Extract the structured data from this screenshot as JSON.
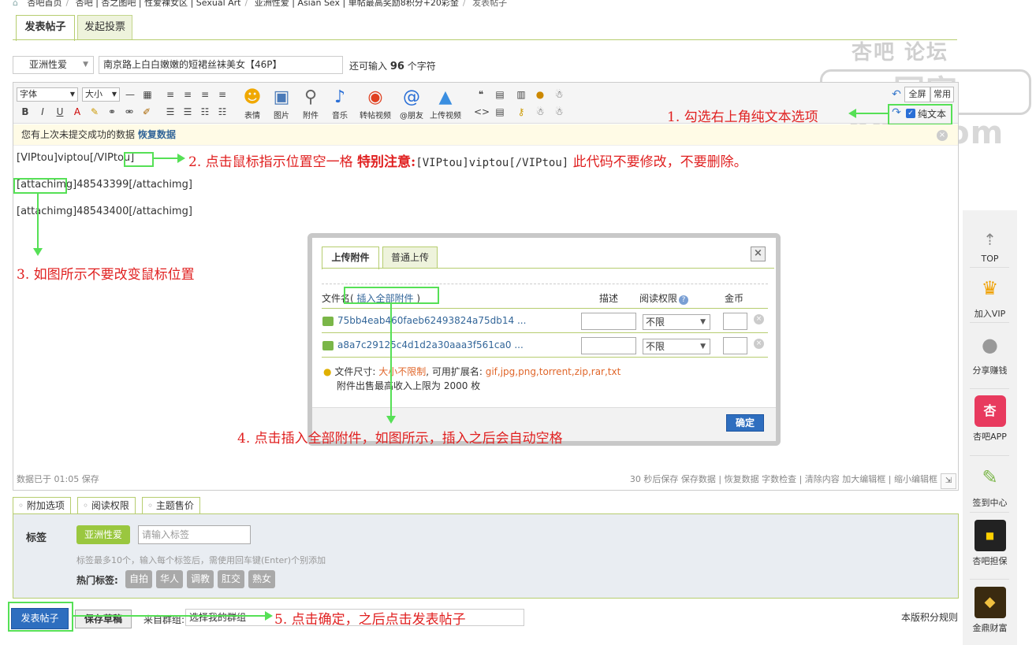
{
  "breadcrumb": {
    "items": [
      "杏吧首页",
      "杏吧 | 杏之图吧 | 性爱裸女区 | Sexual Art",
      "亚洲性爱 | Asian Sex | 单帖最高奖励8积分+20彩金",
      "发表帖子"
    ]
  },
  "tabs": {
    "post": "发表帖子",
    "poll": "发起投票"
  },
  "watermark": {
    "top": "杏吧    论坛",
    "box": "回家001.com"
  },
  "form": {
    "category": "亚洲性爱",
    "title": "南京路上白白嫩嫩的短裙丝袜美女【46P】",
    "char_prefix": "还可输入",
    "char_count": "96",
    "char_suffix": "个字符"
  },
  "toolbar": {
    "font": "字体",
    "size": "大小",
    "fullscreen": "全屏",
    "common": "常用",
    "plaintext": "纯文本",
    "buttons": [
      "表情",
      "图片",
      "附件",
      "音乐",
      "转帖视频",
      "@朋友",
      "上传视频"
    ]
  },
  "notice": {
    "text": "您有上次未提交成功的数据",
    "link": "恢复数据"
  },
  "editor": {
    "lines": [
      "[VIPtou]viptou[/VIPtou]",
      "[attachimg]48543399[/attachimg]",
      "[attachimg]48543400[/attachimg]"
    ],
    "saved": "数据已于 01:05 保存",
    "status_right": "30 秒后保存 保存数据 | 恢复数据    字数检查 | 清除内容    加大编辑框 | 缩小编辑框"
  },
  "annotations": {
    "a1": "1. 勾选右上角纯文本选项",
    "a2": "2. 点击鼠标指示位置空一格",
    "a2b": "特别注意:",
    "a2c": "[VIPtou]viptou[/VIPtou]",
    "a2d": "此代码不要修改，不要删除。",
    "a3": "3. 如图所示不要改变鼠标位置",
    "a4": "4. 点击插入全部附件，如图所示，插入之后会自动空格",
    "a5": "5. 点击确定，之后点击发表帖子"
  },
  "dialog": {
    "tab_upload": "上传附件",
    "tab_normal": "普通上传",
    "col_filename": "文件名(",
    "insert_all": "插入全部附件",
    "col_filename_end": ")",
    "col_desc": "描述",
    "col_perm": "阅读权限",
    "col_coin": "金币",
    "files": [
      {
        "name": "75bb4eab460faeb62493824a75db14 ...",
        "perm": "不限"
      },
      {
        "name": "a8a7c29125c4d1d2a30aaa3f561ca0 ...",
        "perm": "不限"
      }
    ],
    "tip_size_label": "文件尺寸:",
    "tip_size": "大小不限制",
    "tip_ext_label": ", 可用扩展名:",
    "tip_ext": "gif,jpg,png,torrent,zip,rar,txt",
    "tip_limit": "附件出售最高收入上限为 2000 枚",
    "ok": "确定"
  },
  "options": {
    "tabs": [
      "附加选项",
      "阅读权限",
      "主题售价"
    ],
    "tag_label": "标签",
    "tag_chip": "亚洲性爱",
    "tag_placeholder": "请输入标签",
    "tag_hint": "标签最多10个，输入每个标签后，需使用回车键(Enter)个别添加",
    "hot_label": "热门标签:",
    "hot_tags": [
      "自拍",
      "华人",
      "调教",
      "肛交",
      "熟女"
    ]
  },
  "bottom": {
    "post": "发表帖子",
    "draft": "保存草稿",
    "group_label": "来自群组:",
    "group_select": "选择我的群组",
    "rules": "本版积分规则"
  },
  "floatbar": [
    "TOP",
    "加入VIP",
    "分享赚钱",
    "杏吧APP",
    "签到中心",
    "杏吧担保",
    "金鼎财富"
  ]
}
